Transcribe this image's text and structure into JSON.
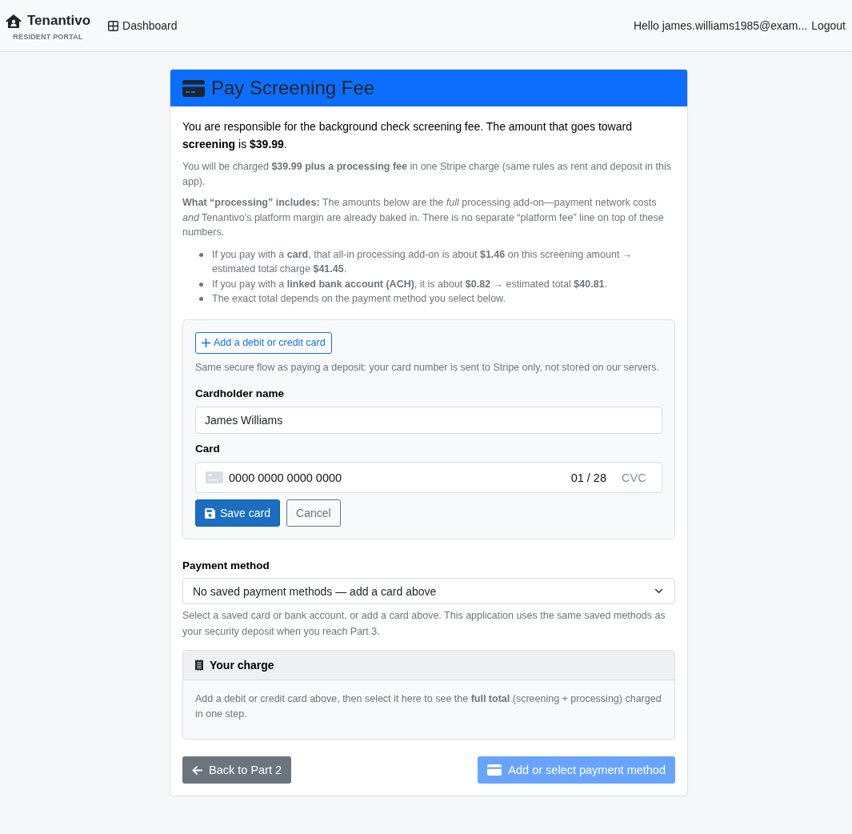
{
  "navbar": {
    "brand": {
      "name": "Tenantivo",
      "subtitle": "RESIDENT PORTAL"
    },
    "nav_links": [
      {
        "label": "Dashboard"
      }
    ],
    "greeting": "Hello james.williams1985@exam...",
    "logout": "Logout"
  },
  "card": {
    "title": "Pay Screening Fee",
    "intro": "You are responsible for the background check screening fee. The amount that goes toward **screening** is **$39.99**.",
    "charge_note": "You will be charged **$39.99 plus a processing fee** in one Stripe charge (same rules as rent and deposit in this app).",
    "processing_note": "**What “processing” includes:** The amounts below are the *full* processing add-on—payment network costs *and* Tenantivo’s platform margin are already baked in. There is no separate “platform fee” line on top of these numbers.",
    "bullets": [
      "If you pay with a **card**, that all-in processing add-on is about **$1.46** on this screening amount → estimated total charge **$41.45**.",
      "If you pay with a **linked bank account (ACH)**, it is about **$0.82** → estimated total **$40.81**.",
      "The exact total depends on the payment method you select below."
    ]
  },
  "add_card_panel": {
    "add_button": "Add a debit or credit card",
    "note": "Same secure flow as paying a deposit: your card number is sent to Stripe only, not stored on our servers.",
    "cardholder_label": "Cardholder name",
    "cardholder_value": "James Williams",
    "card_label": "Card",
    "card_number": "0000 0000 0000 0000",
    "card_expiry": "01 / 28",
    "card_cvc_placeholder": "CVC",
    "actions": [
      {
        "label": "Save card",
        "kind": "primary"
      },
      {
        "label": "Cancel",
        "kind": "secondary"
      }
    ]
  },
  "payment_method": {
    "label": "Payment method",
    "value": "No saved payment methods — add a card above",
    "help": "Select a saved card or bank account, or add a card above. This application uses the same saved methods as your security deposit when you reach Part 3."
  },
  "charge_summary": {
    "title": "Your charge",
    "text": "Add a debit or credit card above, then select it here to see the **full total** (screening + processing) charged in one step."
  },
  "footer_buttons": [
    {
      "label": "Back to Part 2",
      "kind": "back",
      "disabled": false
    },
    {
      "label": "Add or select payment method",
      "kind": "pay",
      "disabled": true
    }
  ]
}
